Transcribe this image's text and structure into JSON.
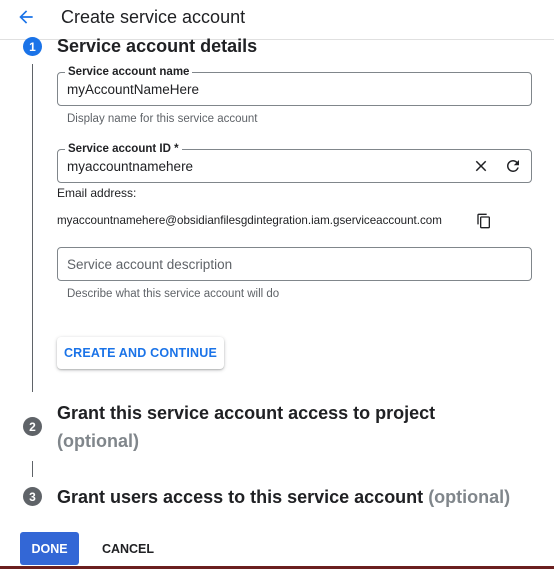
{
  "header": {
    "title": "Create service account",
    "back_icon": "arrow-back-icon"
  },
  "colors": {
    "accent": "#1a73e8",
    "done_button": "#3367d6",
    "step_inactive": "#5f6368",
    "optional_text": "#80868b"
  },
  "steps": [
    {
      "number": "1",
      "title": "Service account details",
      "state": "active"
    },
    {
      "number": "2",
      "title": "Grant this service account access to project",
      "optional": "(optional)",
      "state": "inactive"
    },
    {
      "number": "3",
      "title": "Grant users access to this service account",
      "optional": "(optional)",
      "state": "inactive"
    }
  ],
  "form": {
    "name": {
      "label": "Service account name",
      "value": "myAccountNameHere",
      "hint": "Display name for this service account"
    },
    "id": {
      "label": "Service account ID *",
      "value": "myaccountnamehere",
      "clear_icon": "close-icon",
      "refresh_icon": "refresh-icon"
    },
    "email": {
      "label": "Email address:",
      "value": "myaccountnamehere@obsidianfilesgdintegration.iam.gserviceaccount.com",
      "copy_icon": "copy-icon"
    },
    "description": {
      "placeholder": "Service account description",
      "value": "",
      "hint": "Describe what this service account will do"
    },
    "create_button": "CREATE AND CONTINUE"
  },
  "footer": {
    "done_label": "DONE",
    "cancel_label": "CANCEL"
  }
}
